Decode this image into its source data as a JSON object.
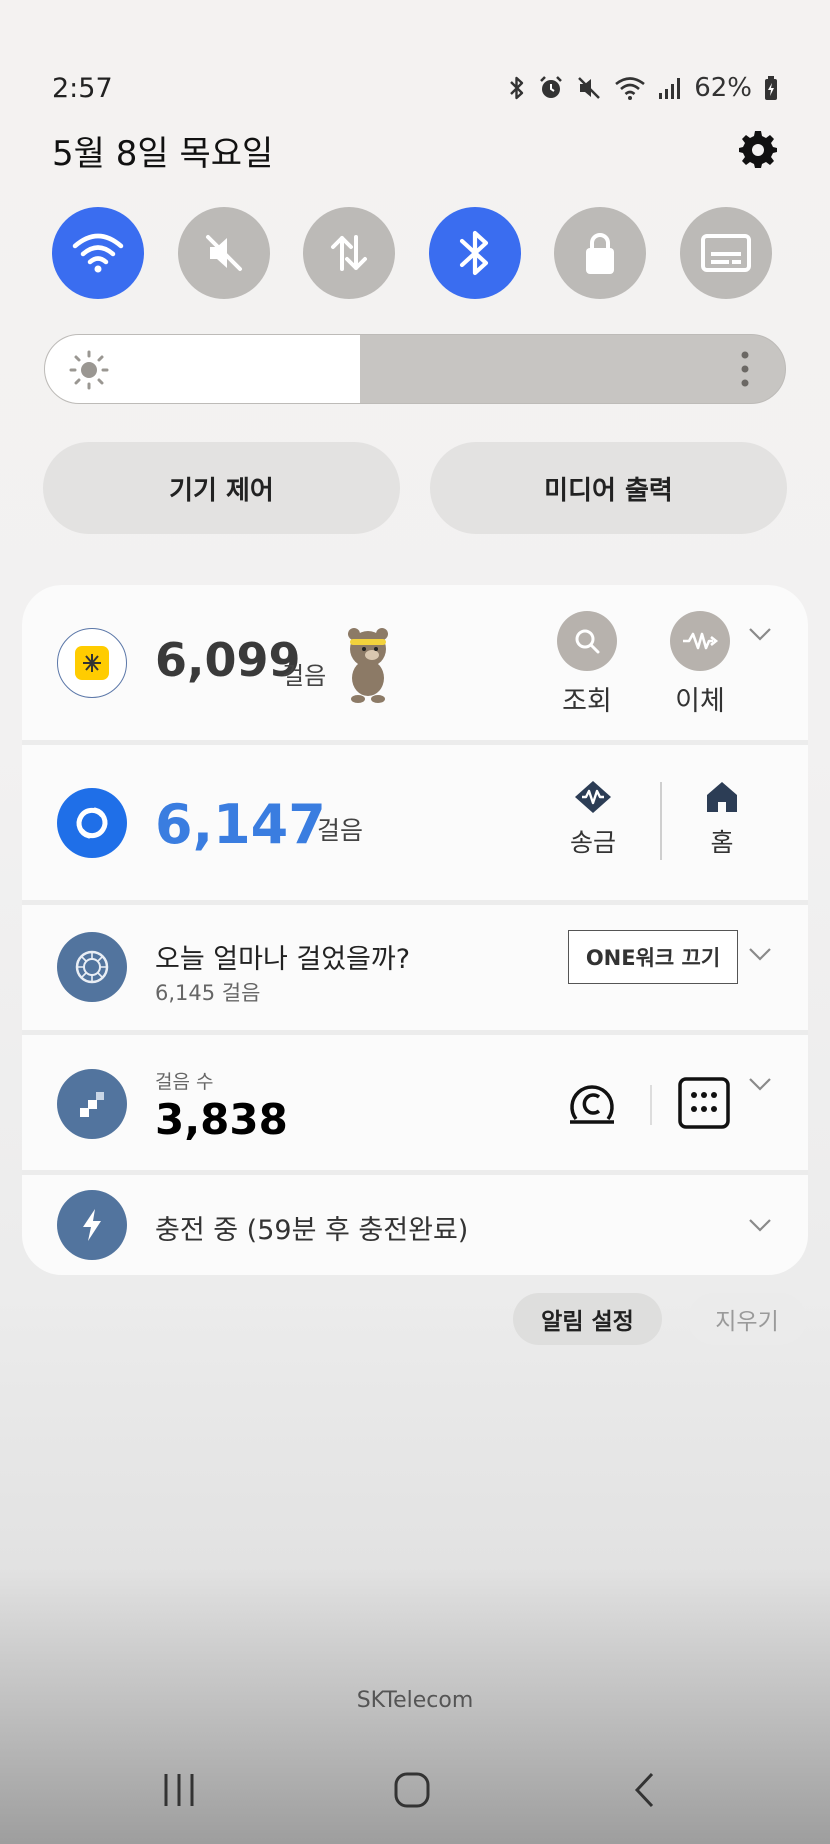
{
  "status_bar": {
    "time": "2:57",
    "battery": "62%",
    "icons": [
      "bluetooth-icon",
      "alarm-icon",
      "mute-icon",
      "wifi-icon",
      "signal-icon",
      "battery-charging-icon"
    ]
  },
  "date": "5월 8일 목요일",
  "quick_settings": [
    {
      "name": "wifi",
      "icon": "wifi-icon",
      "state": "on"
    },
    {
      "name": "sound",
      "icon": "mute-icon",
      "state": "off"
    },
    {
      "name": "mobile-data",
      "icon": "data-transfer-icon",
      "state": "off"
    },
    {
      "name": "bluetooth",
      "icon": "bluetooth-icon",
      "state": "on"
    },
    {
      "name": "lock",
      "icon": "lock-icon",
      "state": "off"
    },
    {
      "name": "caption",
      "icon": "caption-icon",
      "state": "off"
    }
  ],
  "brightness": {
    "level": 0.425
  },
  "pills": {
    "device_control": "기기 제어",
    "media_output": "미디어 출력"
  },
  "notifications": [
    {
      "steps": "6,099",
      "unit": "걸음",
      "actions": [
        {
          "label": "조회",
          "icon": "search-icon"
        },
        {
          "label": "이체",
          "icon": "transfer-icon"
        }
      ]
    },
    {
      "steps": "6,147",
      "unit": "걸음",
      "actions": [
        {
          "label": "송금",
          "icon": "send-money-icon"
        },
        {
          "label": "홈",
          "icon": "home-icon"
        }
      ]
    },
    {
      "title": "오늘 얼마나 걸었을까?",
      "subtitle": "6,145 걸음",
      "button": "ONE워크 끄기"
    },
    {
      "label": "걸음 수",
      "steps": "3,838"
    },
    {
      "text": "충전 중 (59분 후 충전완료)"
    }
  ],
  "footer": {
    "settings_label": "알림 설정",
    "clear_label": "지우기"
  },
  "carrier": "SKTelecom",
  "colors": {
    "accent": "#3a6df0",
    "steps_blue": "#3a7de0",
    "card_icon": "#52749e"
  }
}
